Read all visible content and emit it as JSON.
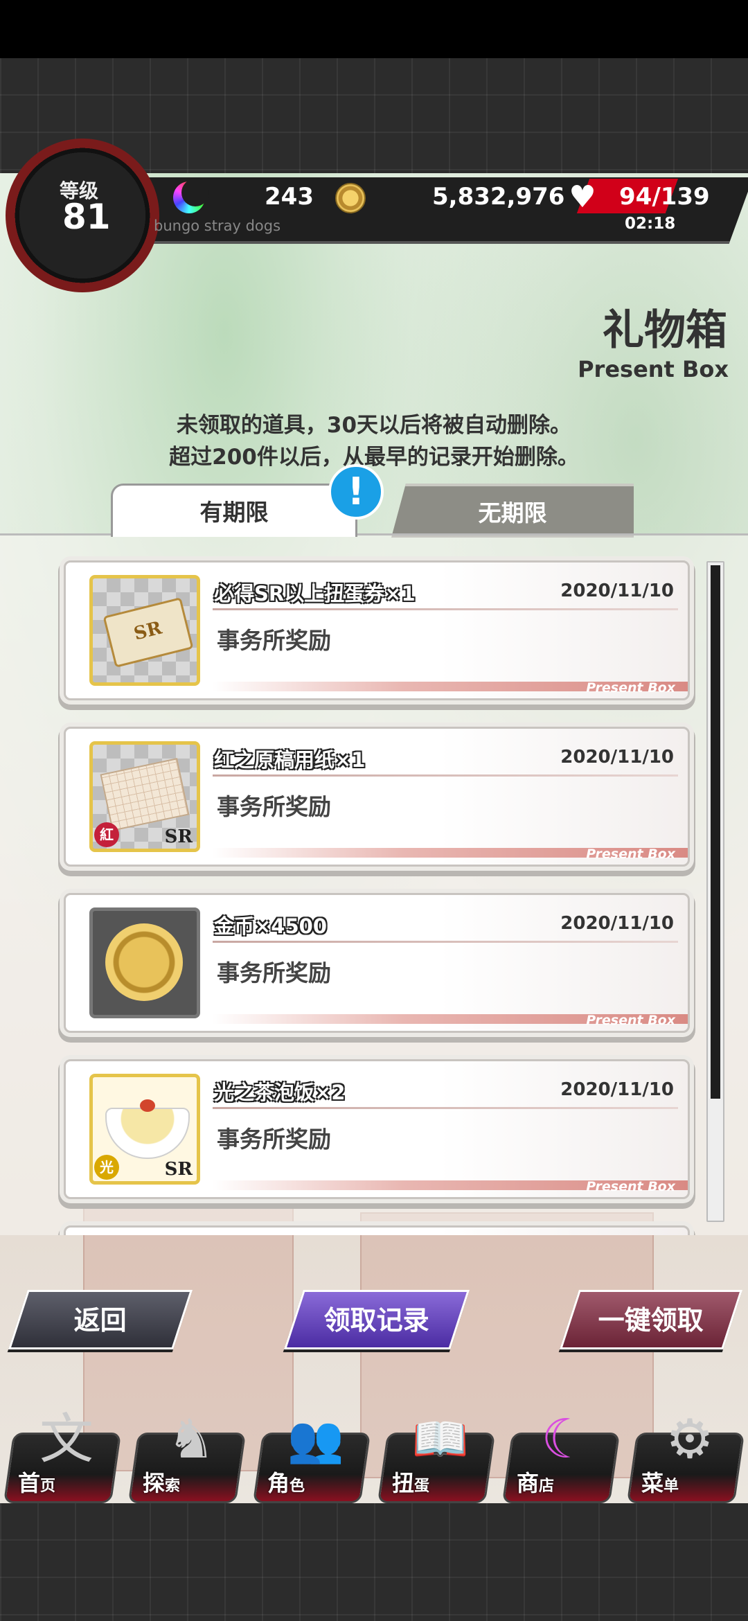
{
  "hud": {
    "level_label": "等级",
    "level": "81",
    "crystals": "243",
    "coins": "5,832,976",
    "stamina": "94/139",
    "stamina_fraction": 0.68,
    "stamina_timer": "02:18",
    "brand": "bungo stray dogs"
  },
  "header": {
    "title_cn": "礼物箱",
    "title_en": "Present Box",
    "notice_1": "未领取的道具，30天以后将被自动删除。",
    "notice_2": "超过200件以后，从最早的记录开始删除。"
  },
  "tabs": [
    {
      "label": "有期限",
      "active": true
    },
    {
      "label": "无期限",
      "active": false
    }
  ],
  "alert_badge": "!",
  "items": [
    {
      "title": "必得SR以上扭蛋券×1",
      "date": "2020/11/10",
      "source": "事务所奖励",
      "tag": "Present Box",
      "icon": "sr-ticket-icon",
      "art_text": "SR",
      "rarity": "",
      "element": ""
    },
    {
      "title": "红之原稿用纸×1",
      "date": "2020/11/10",
      "source": "事务所奖励",
      "tag": "Present Box",
      "icon": "manuscript-paper-icon",
      "art_text": "",
      "rarity": "SR",
      "element": "紅"
    },
    {
      "title": "金币×4500",
      "date": "2020/11/10",
      "source": "事务所奖励",
      "tag": "Present Box",
      "icon": "gold-coin-icon",
      "art_text": "",
      "rarity": "",
      "element": ""
    },
    {
      "title": "光之茶泡饭×2",
      "date": "2020/11/10",
      "source": "事务所奖励",
      "tag": "Present Box",
      "icon": "ochazuke-bowl-icon",
      "art_text": "",
      "rarity": "SR",
      "element": "光"
    }
  ],
  "buttons": {
    "back": "返回",
    "history": "领取记录",
    "claim_all": "一键领取"
  },
  "nav": [
    {
      "label": "首",
      "sub": "页",
      "icon": "home-bungo-icon",
      "glyph": "文"
    },
    {
      "label": "探",
      "sub": "索",
      "icon": "tiger-explore-icon",
      "glyph": "♞"
    },
    {
      "label": "角",
      "sub": "色",
      "icon": "characters-icon",
      "glyph": "👥"
    },
    {
      "label": "扭",
      "sub": "蛋",
      "icon": "gacha-book-icon",
      "glyph": "📖"
    },
    {
      "label": "商",
      "sub": "店",
      "icon": "shop-moon-icon",
      "glyph": "☾"
    },
    {
      "label": "菜",
      "sub": "单",
      "icon": "menu-gear-icon",
      "glyph": "⚙"
    }
  ],
  "colors": {
    "stamina_red": "#d10019",
    "alert_blue": "#1aa0e6",
    "history_purple": "#4b2ca3",
    "claim_all_maroon": "#6b2336"
  }
}
